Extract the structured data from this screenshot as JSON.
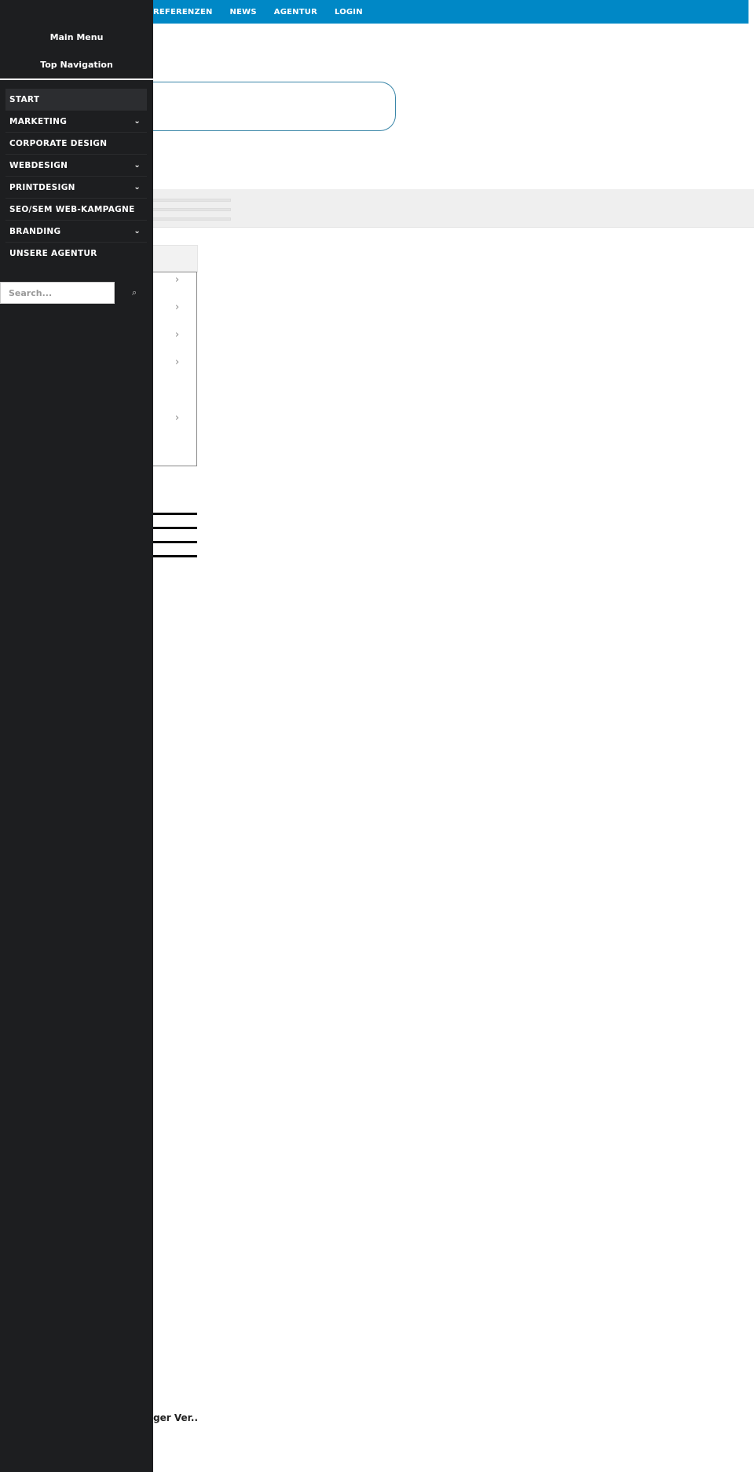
{
  "topnav": {
    "items": [
      "REFERENZEN",
      "NEWS",
      "AGENTUR",
      "LOGIN"
    ],
    "color": "#0088c6"
  },
  "sidebar": {
    "title": "Main Menu",
    "subtitle": "Top Navigation",
    "items": [
      {
        "label": "START",
        "active": true,
        "has_children": false
      },
      {
        "label": "MARKETING",
        "has_children": true
      },
      {
        "label": "CORPORATE DESIGN",
        "has_children": false
      },
      {
        "label": "WEBDESIGN",
        "has_children": true
      },
      {
        "label": "PRINTDESIGN",
        "has_children": true
      },
      {
        "label": "SEO/SEM WEB-KAMPAGNE",
        "has_children": false
      },
      {
        "label": "BRANDING",
        "has_children": true
      },
      {
        "label": "UNSERE AGENTUR",
        "has_children": false
      }
    ],
    "search": {
      "placeholder": "Search...",
      "icon": "search-icon"
    },
    "background": "#1d1e20"
  },
  "main": {
    "snippet": "änger Ver.."
  }
}
